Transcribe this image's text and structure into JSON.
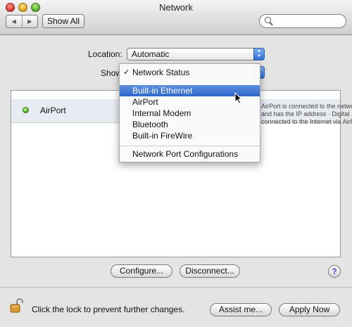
{
  "window": {
    "title": "Network"
  },
  "toolbar": {
    "back_label": "◀",
    "forward_label": "▶",
    "show_all_label": "Show All",
    "search": {
      "value": "",
      "placeholder": ""
    }
  },
  "location": {
    "label": "Location:",
    "value": "Automatic"
  },
  "show": {
    "label": "Show",
    "menu": {
      "items": [
        {
          "label": "Network Status",
          "checked": true
        },
        {
          "label": "Built-in Ethernet",
          "highlighted": true
        },
        {
          "label": "AirPort"
        },
        {
          "label": "Internal Modem"
        },
        {
          "label": "Bluetooth"
        },
        {
          "label": "Built-in FireWire"
        }
      ],
      "footer_item": {
        "label": "Network Port Configurations"
      }
    }
  },
  "list": {
    "rows": [
      {
        "name": "AirPort",
        "status_color": "#3f9d13",
        "detail_lines": [
          "AirPort is connected to the network",
          "and has the IP address · Digital",
          "connected to the Internet via AirPort."
        ]
      }
    ]
  },
  "buttons": {
    "configure": "Configure...",
    "disconnect": "Disconnect...",
    "help": "?",
    "assist": "Assist me...",
    "apply": "Apply Now"
  },
  "lock": {
    "text": "Click the lock to prevent further changes."
  }
}
